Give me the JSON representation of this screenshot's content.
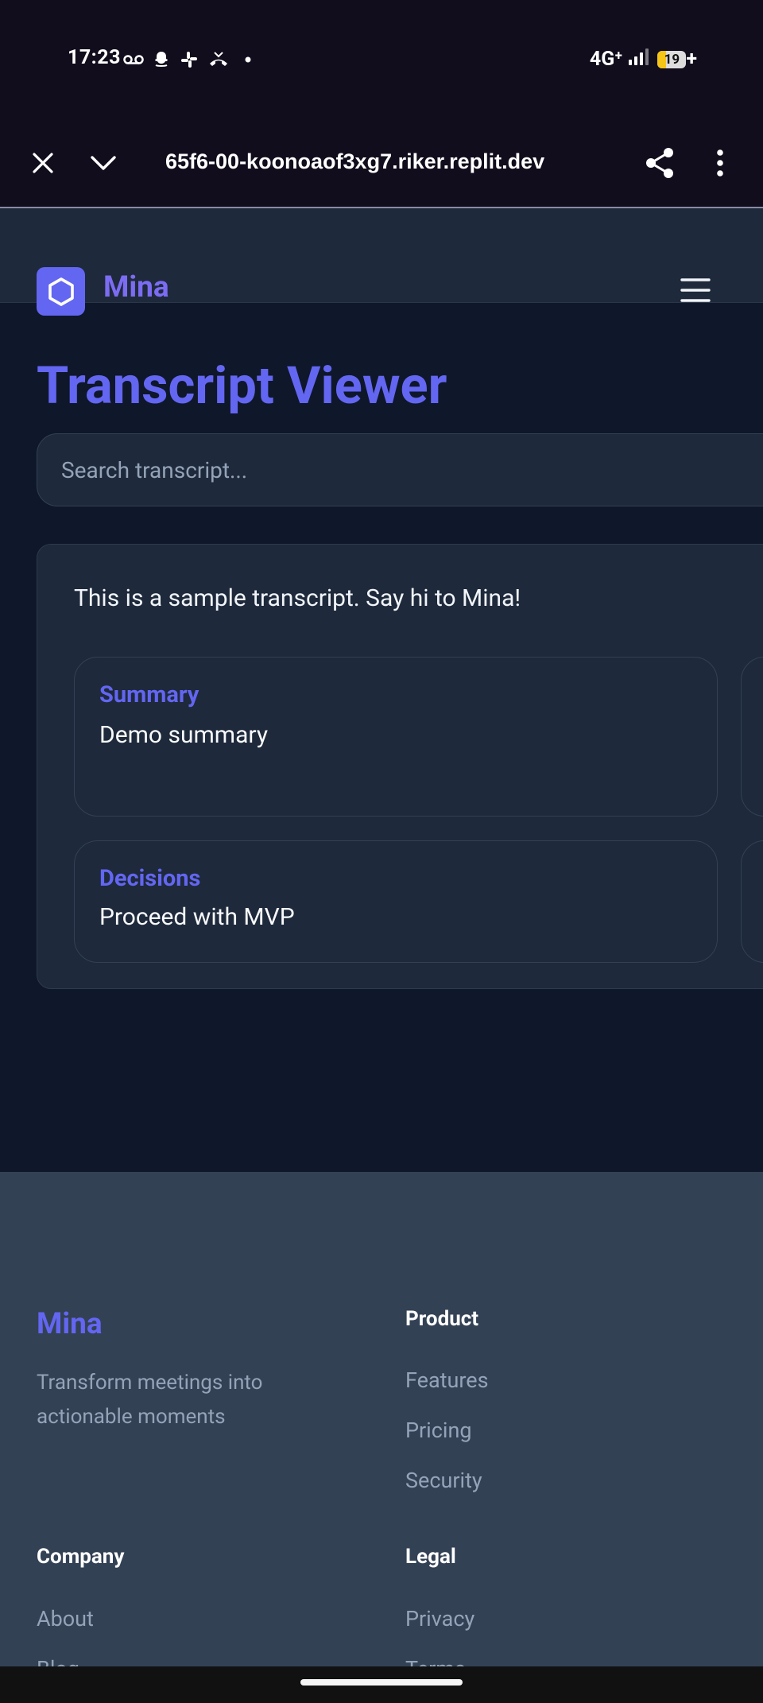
{
  "status_bar": {
    "time": "17:23",
    "network": "4G⁺",
    "battery_level": "19",
    "battery_charging_symbol": "+",
    "notification_icons": [
      "voicemail-icon",
      "snapchat-icon",
      "slack-icon",
      "missed-call-icon",
      "more-dot-icon"
    ]
  },
  "browser": {
    "url": "65f6-00-koonoaof3xg7.riker.replit.dev",
    "icons": [
      "close-icon",
      "chevron-down-icon",
      "share-icon",
      "more-vert-icon"
    ]
  },
  "header": {
    "brand": "Mina",
    "menu_icon": "hamburger-icon"
  },
  "main": {
    "title": "Transcript Viewer",
    "search_placeholder": "Search transcript...",
    "transcript_text": "This is a sample transcript. Say hi to Mina!",
    "cards": [
      {
        "label": "Summary",
        "value": "Demo summary"
      },
      {
        "label": "Decisions",
        "value": "Proceed with MVP"
      }
    ]
  },
  "footer": {
    "brand": "Mina",
    "tagline": "Transform meetings into actionable moments",
    "product": {
      "heading": "Product",
      "links": [
        "Features",
        "Pricing",
        "Security"
      ]
    },
    "company": {
      "heading": "Company",
      "links": [
        "About",
        "Blog"
      ]
    },
    "legal": {
      "heading": "Legal",
      "links": [
        "Privacy",
        "Terms"
      ]
    }
  },
  "colors": {
    "accent": "#6366f1",
    "page_bg": "#0f172a",
    "card_bg": "#1e293b",
    "footer_bg": "#334155",
    "muted_text": "#94a3b8"
  }
}
